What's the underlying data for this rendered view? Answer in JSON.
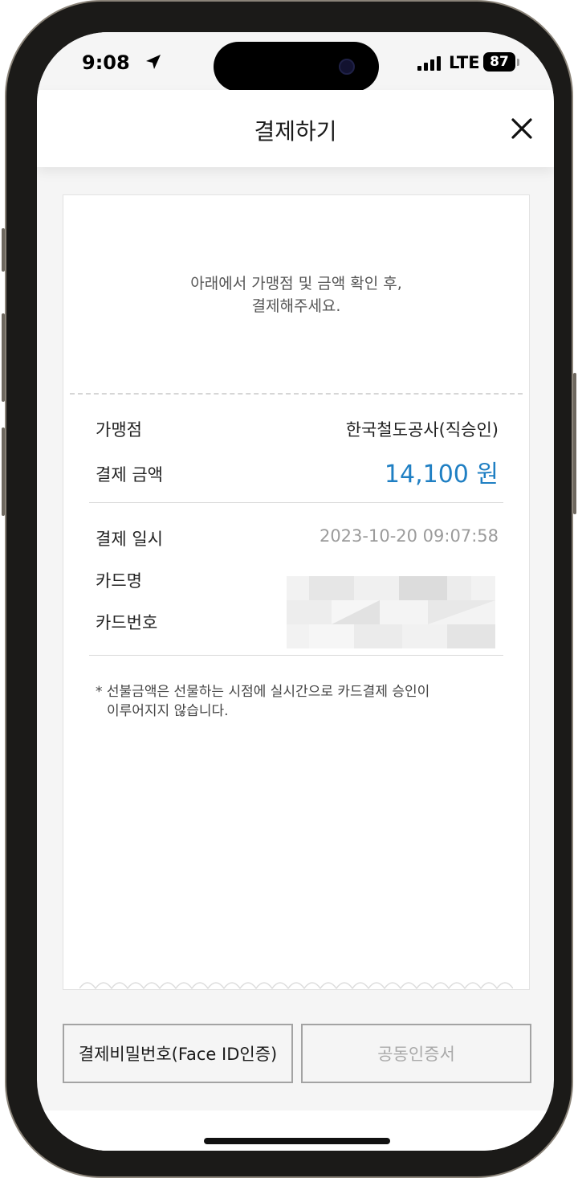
{
  "status": {
    "time": "9:08",
    "network": "LTE",
    "battery": "87"
  },
  "header": {
    "title": "결제하기",
    "close_icon": "close-icon"
  },
  "receipt": {
    "intro_line1": "아래에서 가맹점 및 금액 확인 후,",
    "intro_line2": "결제해주세요.",
    "merchant_label": "가맹점",
    "merchant_value": "한국철도공사(직승인)",
    "amount_label": "결제 금액",
    "amount_value": "14,100 원",
    "datetime_label": "결제 일시",
    "datetime_value": "2023-10-20 09:07:58",
    "card_name_label": "카드명",
    "card_number_label": "카드번호",
    "note_line1": "* 선불금액은 선물하는 시점에 실시간으로 카드결제 승인이",
    "note_line2": "이루어지지 않습니다."
  },
  "buttons": {
    "face_id": "결제비밀번호(Face ID인증)",
    "certificate": "공동인증서"
  },
  "colors": {
    "accent": "#1f7fc3",
    "background": "#f5f5f5"
  }
}
